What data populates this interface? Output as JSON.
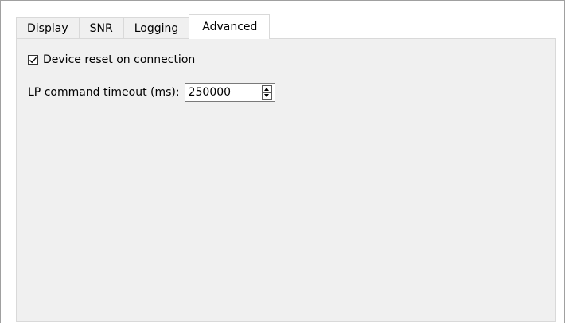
{
  "tabs": [
    {
      "label": "Display",
      "active": false
    },
    {
      "label": "SNR",
      "active": false
    },
    {
      "label": "Logging",
      "active": false
    },
    {
      "label": "Advanced",
      "active": true
    }
  ],
  "advanced": {
    "device_reset": {
      "label": "Device reset on connection",
      "checked": true
    },
    "lp_timeout": {
      "label": "LP command timeout (ms):",
      "value": "250000"
    }
  },
  "colors": {
    "panel_background": "#f0f0f0",
    "active_tab_background": "#ffffff",
    "border": "#d9d9d9"
  },
  "icons": {
    "checkbox": "checkmark-icon",
    "spin_up": "spin-up-arrow-icon",
    "spin_down": "spin-down-arrow-icon"
  }
}
